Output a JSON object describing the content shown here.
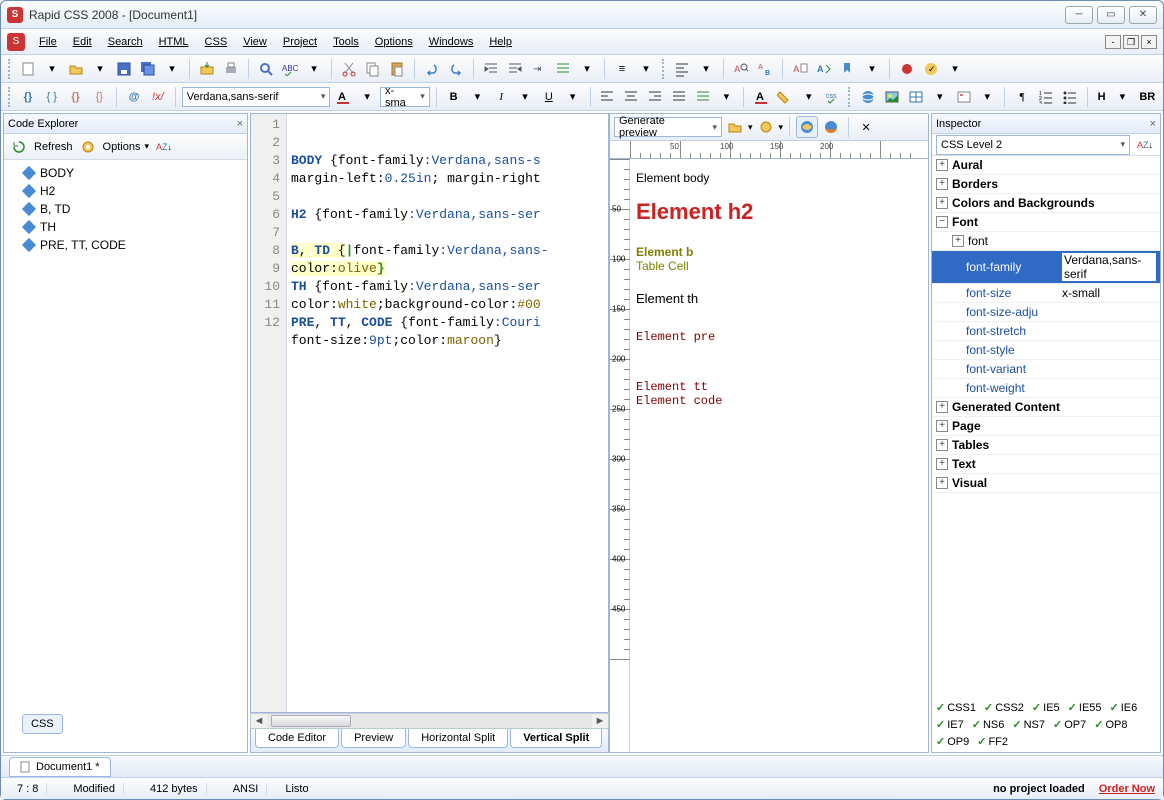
{
  "title": "Rapid CSS 2008 - [Document1]",
  "menus": [
    "File",
    "Edit",
    "Search",
    "HTML",
    "CSS",
    "View",
    "Project",
    "Tools",
    "Options",
    "Windows",
    "Help"
  ],
  "toolbar2": {
    "font_family": "Verdana,sans-serif",
    "font_size": "x-sma",
    "br": "BR"
  },
  "code_explorer": {
    "title": "Code Explorer",
    "refresh": "Refresh",
    "options": "Options",
    "items": [
      "BODY",
      "H2",
      "B, TD",
      "TH",
      "PRE, TT, CODE"
    ]
  },
  "editor": {
    "lines": [
      1,
      2,
      3,
      4,
      5,
      6,
      7,
      8,
      9,
      10,
      11,
      12
    ],
    "tabs": [
      "Code Editor",
      "Preview",
      "Horizontal Split",
      "Vertical Split"
    ],
    "active_tab": 3
  },
  "code": {
    "l2a": "BODY",
    "l2b": " {",
    "l2c": "font-family",
    "l2d": ":Verdana,sans-s",
    "l3a": "margin-left",
    "l3b": ":",
    "l3c": "0.25in",
    "l3d": "; ",
    "l3e": "margin-right",
    "l5a": "H2",
    "l5b": " {",
    "l5c": "font-family",
    "l5d": ":Verdana,sans-ser",
    "l7a": "B",
    "l7b": ", ",
    "l7c": "TD",
    "l7d": " {",
    "l7e": "font-family",
    "l7f": ":Verdana,sans-",
    "l8a": "color",
    "l8b": ":",
    "l8c": "olive",
    "l8d": "}",
    "l9a": "TH",
    "l9b": " {",
    "l9c": "font-family",
    "l9d": ":Verdana,sans-ser",
    "l10a": "color",
    "l10b": ":",
    "l10c": "white",
    "l10d": ";",
    "l10e": "background-color",
    "l10f": ":",
    "l10g": "#00",
    "l11a": "PRE",
    "l11b": ", ",
    "l11c": "TT",
    "l11d": ", ",
    "l11e": "CODE",
    "l11f": " {",
    "l11g": "font-family",
    "l11h": ":Couri",
    "l12a": "font-size",
    "l12b": ":",
    "l12c": "9pt",
    "l12d": ";",
    "l12e": "color",
    "l12f": ":",
    "l12g": "maroon",
    "l12h": "}"
  },
  "preview": {
    "generate": "Generate preview",
    "body": "Element body",
    "h2": "Element h2",
    "b": "Element b",
    "td": "Table Cell",
    "th": "Element th",
    "pre": "Element pre",
    "tt": "Element tt",
    "code": "Element code",
    "ruler_h": [
      "50",
      "100",
      "150",
      "200"
    ],
    "ruler_v": [
      "50",
      "100",
      "150",
      "200",
      "250",
      "300",
      "350",
      "400",
      "450"
    ]
  },
  "inspector": {
    "title": "Inspector",
    "level": "CSS Level 2",
    "cats": [
      "Aural",
      "Borders",
      "Colors and Backgrounds",
      "Font",
      "Generated Content",
      "Page",
      "Tables",
      "Text",
      "Visual"
    ],
    "font_sub": "font",
    "props": [
      {
        "name": "font-family",
        "val": "Verdana,sans-serif",
        "selected": true
      },
      {
        "name": "font-size",
        "val": "x-small"
      },
      {
        "name": "font-size-adju",
        "val": ""
      },
      {
        "name": "font-stretch",
        "val": ""
      },
      {
        "name": "font-style",
        "val": ""
      },
      {
        "name": "font-variant",
        "val": ""
      },
      {
        "name": "font-weight",
        "val": ""
      }
    ],
    "compat": [
      "CSS1",
      "CSS2",
      "IE5",
      "IE55",
      "IE6",
      "IE7",
      "NS6",
      "NS7",
      "OP7",
      "OP8",
      "OP9",
      "FF2"
    ]
  },
  "doc_tab": "Document1 *",
  "css_side_tab": "CSS",
  "status": {
    "pos": "7 : 8",
    "modified": "Modified",
    "bytes": "412 bytes",
    "encoding": "ANSI",
    "ready": "Listo",
    "project": "no project loaded",
    "order": "Order Now"
  }
}
